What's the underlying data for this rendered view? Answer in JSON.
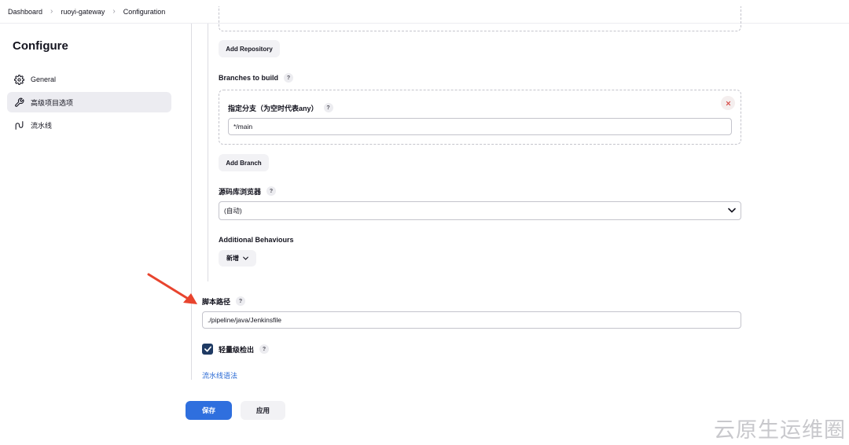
{
  "breadcrumbs": [
    "Dashboard",
    "ruoyi-gateway",
    "Configuration"
  ],
  "sidebar": {
    "title": "Configure",
    "items": [
      {
        "label": "General",
        "icon": "gear-icon",
        "active": false
      },
      {
        "label": "高级项目选项",
        "icon": "wrench-icon",
        "active": true
      },
      {
        "label": "流水线",
        "icon": "pipeline-icon",
        "active": false
      }
    ]
  },
  "scm": {
    "add_repository_label": "Add Repository",
    "branches_label": "Branches to build",
    "branch_specifier_label": "指定分支（为空时代表any）",
    "branch_value": "*/main",
    "add_branch_label": "Add Branch",
    "repo_browser_label": "源码库浏览器",
    "repo_browser_value": "(自动)",
    "additional_behaviours_label": "Additional Behaviours",
    "add_behaviour_label": "新增"
  },
  "script_path": {
    "label": "脚本路径",
    "value": "./pipeline/java/Jenkinsfile"
  },
  "lightweight_checkout": {
    "label": "轻量级检出",
    "checked": true
  },
  "pipeline_syntax_link": "流水线语法",
  "actions": {
    "save_label": "保存",
    "apply_label": "应用"
  },
  "help_glyph": "?",
  "watermark": "云原生运维圈",
  "colors": {
    "primary": "#2f6fde",
    "link": "#2a6ad4",
    "annotation_arrow": "#e8442e",
    "checkbox": "#1f3a63"
  }
}
